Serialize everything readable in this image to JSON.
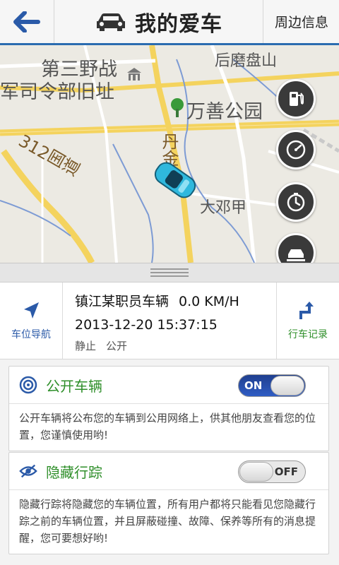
{
  "header": {
    "title": "我的爱车",
    "nearby_label": "周边信息"
  },
  "map": {
    "labels": {
      "place1_line1": "第三野战",
      "place1_line2": "军司令部旧址",
      "place2": "后磨盘山",
      "park": "万善公园",
      "road_danjin": "丹金",
      "road_312": "312国道",
      "place3": "大邓甲"
    },
    "tools": [
      "fuel-icon",
      "speedometer-icon",
      "timer-icon",
      "car-lift-icon"
    ]
  },
  "info": {
    "nav_label": "车位导航",
    "log_label": "行车记录",
    "vehicle_name": "镇江某职员车辆",
    "speed": "0.0 KM/H",
    "timestamp": "2013-12-20 15:37:15",
    "status_motion": "静止",
    "status_visibility": "公开"
  },
  "public_vehicle": {
    "title": "公开车辆",
    "toggle_text": "ON",
    "enabled": true,
    "description": "公开车辆将公布您的车辆到公用网络上，供其他朋友查看您的位置，您谨慎使用哟!"
  },
  "hide_track": {
    "title": "隐藏行踪",
    "toggle_text": "OFF",
    "enabled": false,
    "description": "隐藏行踪将隐藏您的车辆位置，所有用户都将只能看见您隐藏行踪之前的车辆位置，并且屏蔽碰撞、故障、保养等所有的消息提醒，您可要想好哟!"
  },
  "colors": {
    "accent_blue": "#2b6cb0",
    "green": "#2f8f2a"
  }
}
